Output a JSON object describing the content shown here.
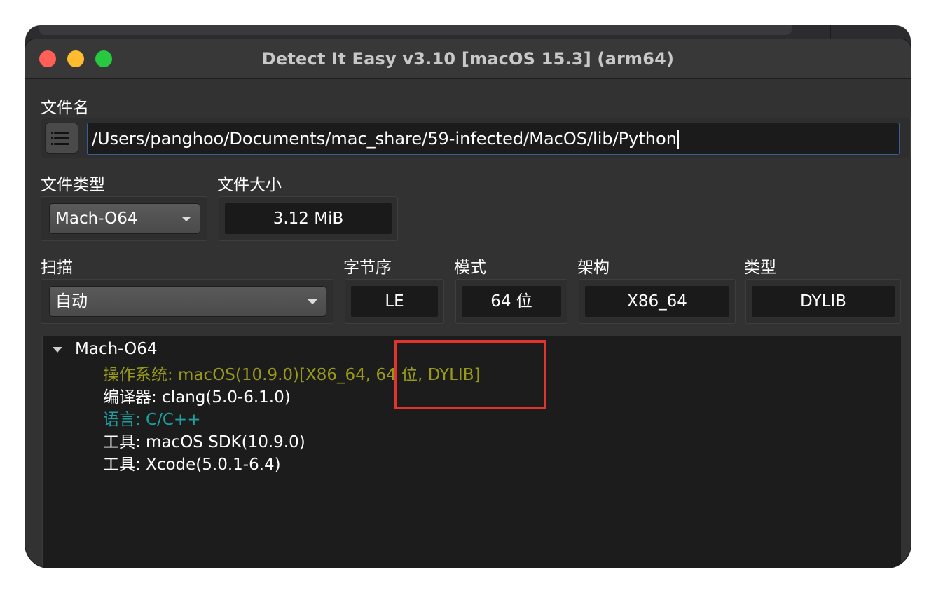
{
  "window": {
    "title": "Detect It Easy v3.10 [macOS 15.3] (arm64)"
  },
  "file": {
    "label": "文件名",
    "path": "/Users/panghoo/Documents/mac_share/59-infected/MacOS/lib/Python"
  },
  "file_type": {
    "label": "文件类型",
    "value": "Mach-O64"
  },
  "file_size": {
    "label": "文件大小",
    "value": "3.12 MiB"
  },
  "scan": {
    "label": "扫描",
    "value": "自动"
  },
  "endianness": {
    "label": "字节序",
    "value": "LE"
  },
  "mode": {
    "label": "模式",
    "value": "64 位"
  },
  "arch": {
    "label": "架构",
    "value": "X86_64"
  },
  "type": {
    "label": "类型",
    "value": "DYLIB"
  },
  "results": {
    "root": "Mach-O64",
    "items": [
      {
        "text": "操作系统: macOS(10.9.0)[X86_64, 64 位, DYLIB]",
        "color": "#9a9a1a"
      },
      {
        "text": "编译器: clang(5.0-6.1.0)",
        "color": "#ffffff"
      },
      {
        "text": "语言: C/C++",
        "color": "#1ea0a0"
      },
      {
        "text": "工具: macOS SDK(10.9.0)",
        "color": "#ffffff"
      },
      {
        "text": "工具: Xcode(5.0.1-6.4)",
        "color": "#ffffff"
      }
    ]
  },
  "annotation": {
    "color": "#e0342c"
  }
}
